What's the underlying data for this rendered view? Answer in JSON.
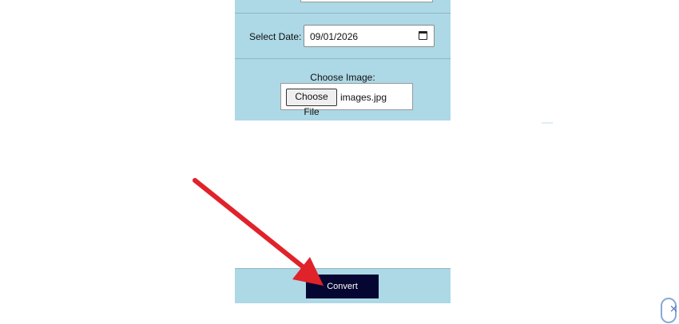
{
  "form": {
    "date_label": "Select Date:",
    "date_value": "09/01/2026",
    "image_label": "Choose Image:",
    "choose_file_label": "Choose File",
    "file_name": "images.jpg"
  },
  "actions": {
    "convert_label": "Convert"
  },
  "widget": {
    "close_glyph": "×"
  },
  "colors": {
    "panel": "#add8e6",
    "convert_button": "#060632",
    "arrow": "#e0222a"
  }
}
